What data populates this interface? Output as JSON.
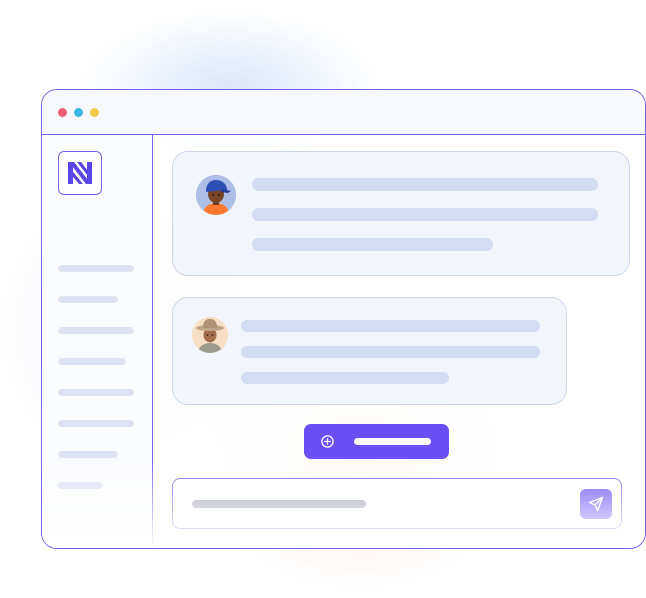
{
  "window": {
    "controls": [
      "close",
      "minimize",
      "maximize"
    ],
    "colors": {
      "close": "#ee5d72",
      "minimize": "#37b8e4",
      "maximize": "#f2c944",
      "border": "#7463e6"
    }
  },
  "sidebar": {
    "logo": {
      "icon": "n-logo-icon",
      "color": "#5a45e6"
    },
    "item_count": 8
  },
  "conversation": {
    "messages": [
      {
        "icon": "person-blue-cap-avatar",
        "line_count": 3
      },
      {
        "icon": "person-sun-hat-avatar",
        "line_count": 3
      }
    ]
  },
  "actions": {
    "new_chat_button": {
      "icon": "plus-circle-icon",
      "label": ""
    }
  },
  "composer": {
    "placeholder": "",
    "value": "",
    "send_icon": "send-icon"
  },
  "theme": {
    "accent": "#6a4ff5",
    "placeholder_bar": "#d4dcf4",
    "glow_pink": "#ffb4b4",
    "glow_blue": "#aac8f0"
  }
}
